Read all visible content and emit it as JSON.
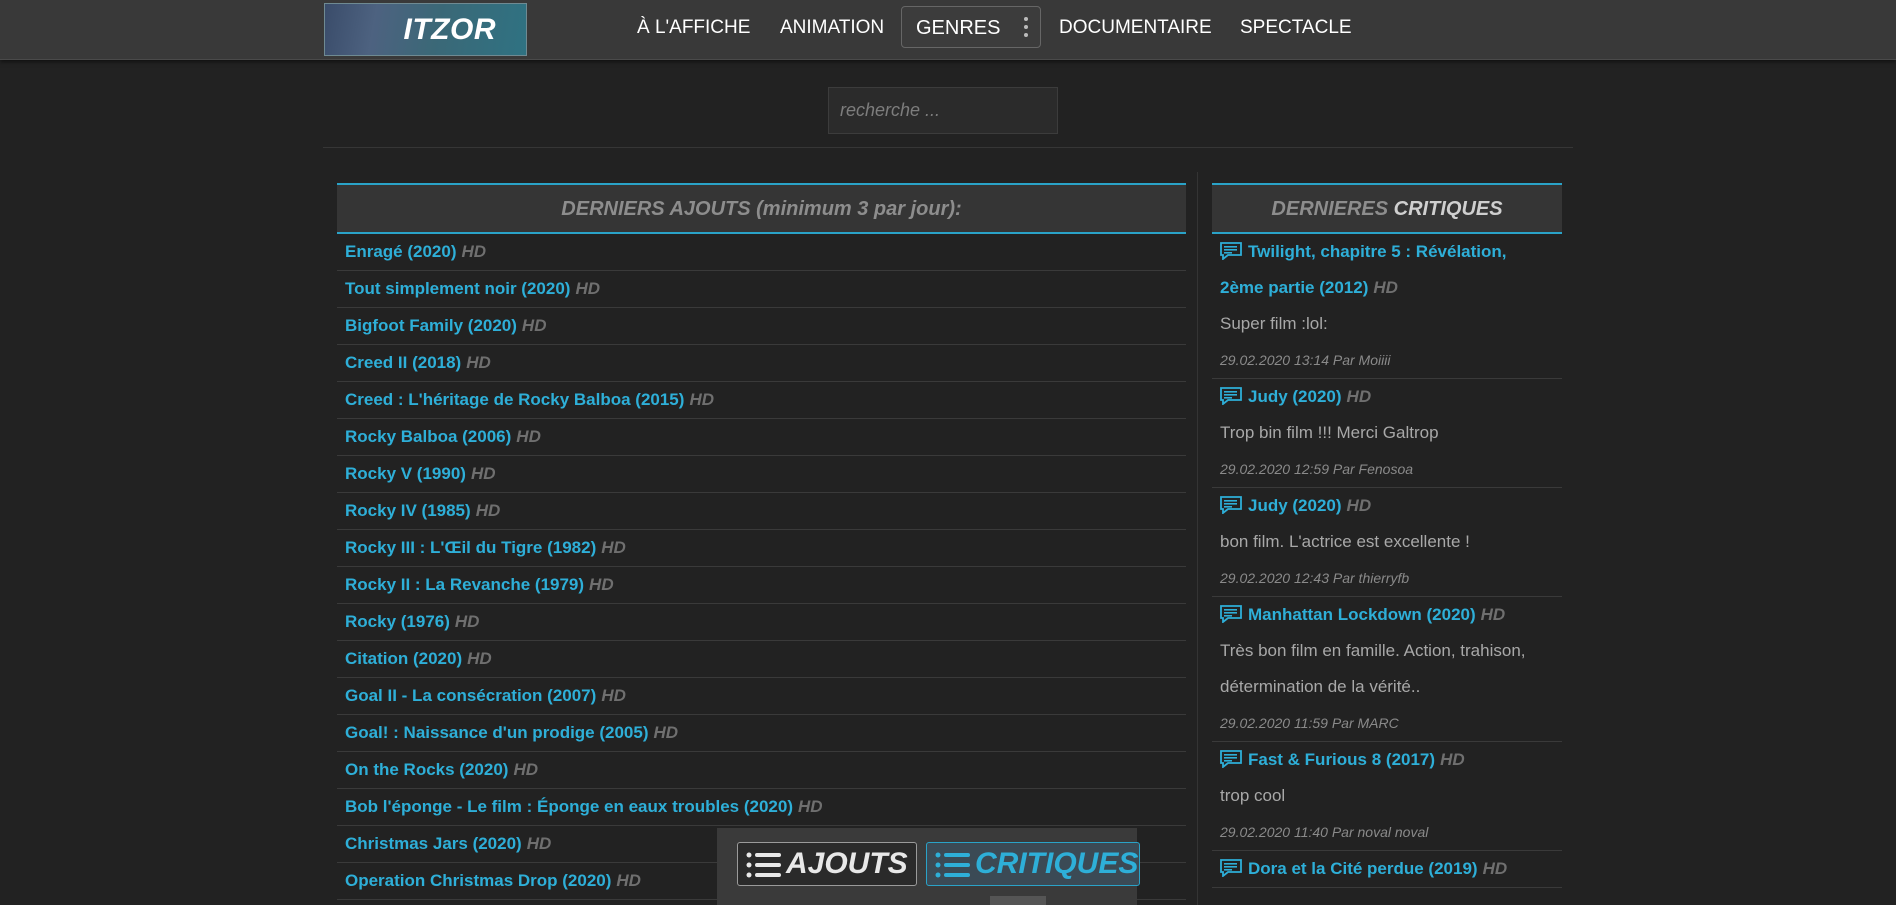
{
  "brand": {
    "logo_text": "ITZOR"
  },
  "nav": {
    "items": [
      "À L'AFFICHE",
      "ANIMATION",
      "DOCUMENTAIRE",
      "SPECTACLE"
    ],
    "genres_label": "GENRES"
  },
  "search": {
    "placeholder": "recherche ..."
  },
  "latest": {
    "header_main": "DERNIERS AJOUTS",
    "header_sub": "(minimum 3 par jour):",
    "quality_label": "HD",
    "items": [
      "Enragé (2020)",
      "Tout simplement noir (2020)",
      "Bigfoot Family (2020)",
      "Creed II (2018)",
      "Creed : L'héritage de Rocky Balboa (2015)",
      "Rocky Balboa (2006)",
      "Rocky V (1990)",
      "Rocky IV (1985)",
      "Rocky III : L'Œil du Tigre (1982)",
      "Rocky II : La Revanche (1979)",
      "Rocky (1976)",
      "Citation (2020)",
      "Goal II - La consécration (2007)",
      "Goal! : Naissance d'un prodige (2005)",
      "On the Rocks (2020)",
      "Bob l'éponge - Le film : Éponge en eaux troubles (2020)",
      "Christmas Jars (2020)",
      "Operation Christmas Drop (2020)"
    ]
  },
  "reviews": {
    "header_main": "DERNIERES",
    "header_sub": "CRITIQUES",
    "items": [
      {
        "title_line1": "Twilight, chapitre 5 : Révélation,",
        "title_line2": "2ème partie (2012)",
        "quality": "HD",
        "text": "Super film :lol:",
        "text_line2": "",
        "meta": "29.02.2020 13:14 Par Moiiii"
      },
      {
        "title_line1": "Judy (2020)",
        "title_line2": "",
        "quality": "HD",
        "text": "Trop bin film !!! Merci Galtrop",
        "text_line2": "",
        "meta": "29.02.2020 12:59 Par Fenosoa"
      },
      {
        "title_line1": "Judy (2020)",
        "title_line2": "",
        "quality": "HD",
        "text": "bon film. L'actrice est excellente !",
        "text_line2": "",
        "meta": "29.02.2020 12:43 Par thierryfb"
      },
      {
        "title_line1": "Manhattan Lockdown (2020)",
        "title_line2": "",
        "quality": "HD",
        "text": "Très bon film en famille. Action, trahison,",
        "text_line2": "détermination de la vérité..",
        "meta": "29.02.2020 11:59 Par MARC"
      },
      {
        "title_line1": "Fast & Furious 8 (2017)",
        "title_line2": "",
        "quality": "HD",
        "text": "trop cool",
        "text_line2": "",
        "meta": "29.02.2020 11:40 Par noval noval"
      },
      {
        "title_line1": "Dora et la Cité perdue (2019)",
        "title_line2": "",
        "quality": "HD",
        "text": "",
        "text_line2": "",
        "meta": ""
      }
    ]
  },
  "toggle": {
    "ajouts_label": "AJOUTS",
    "critiques_label": "CRITIQUES"
  },
  "colors": {
    "accent": "#2aa3c8",
    "link": "#2eafd8",
    "background": "#222222"
  }
}
